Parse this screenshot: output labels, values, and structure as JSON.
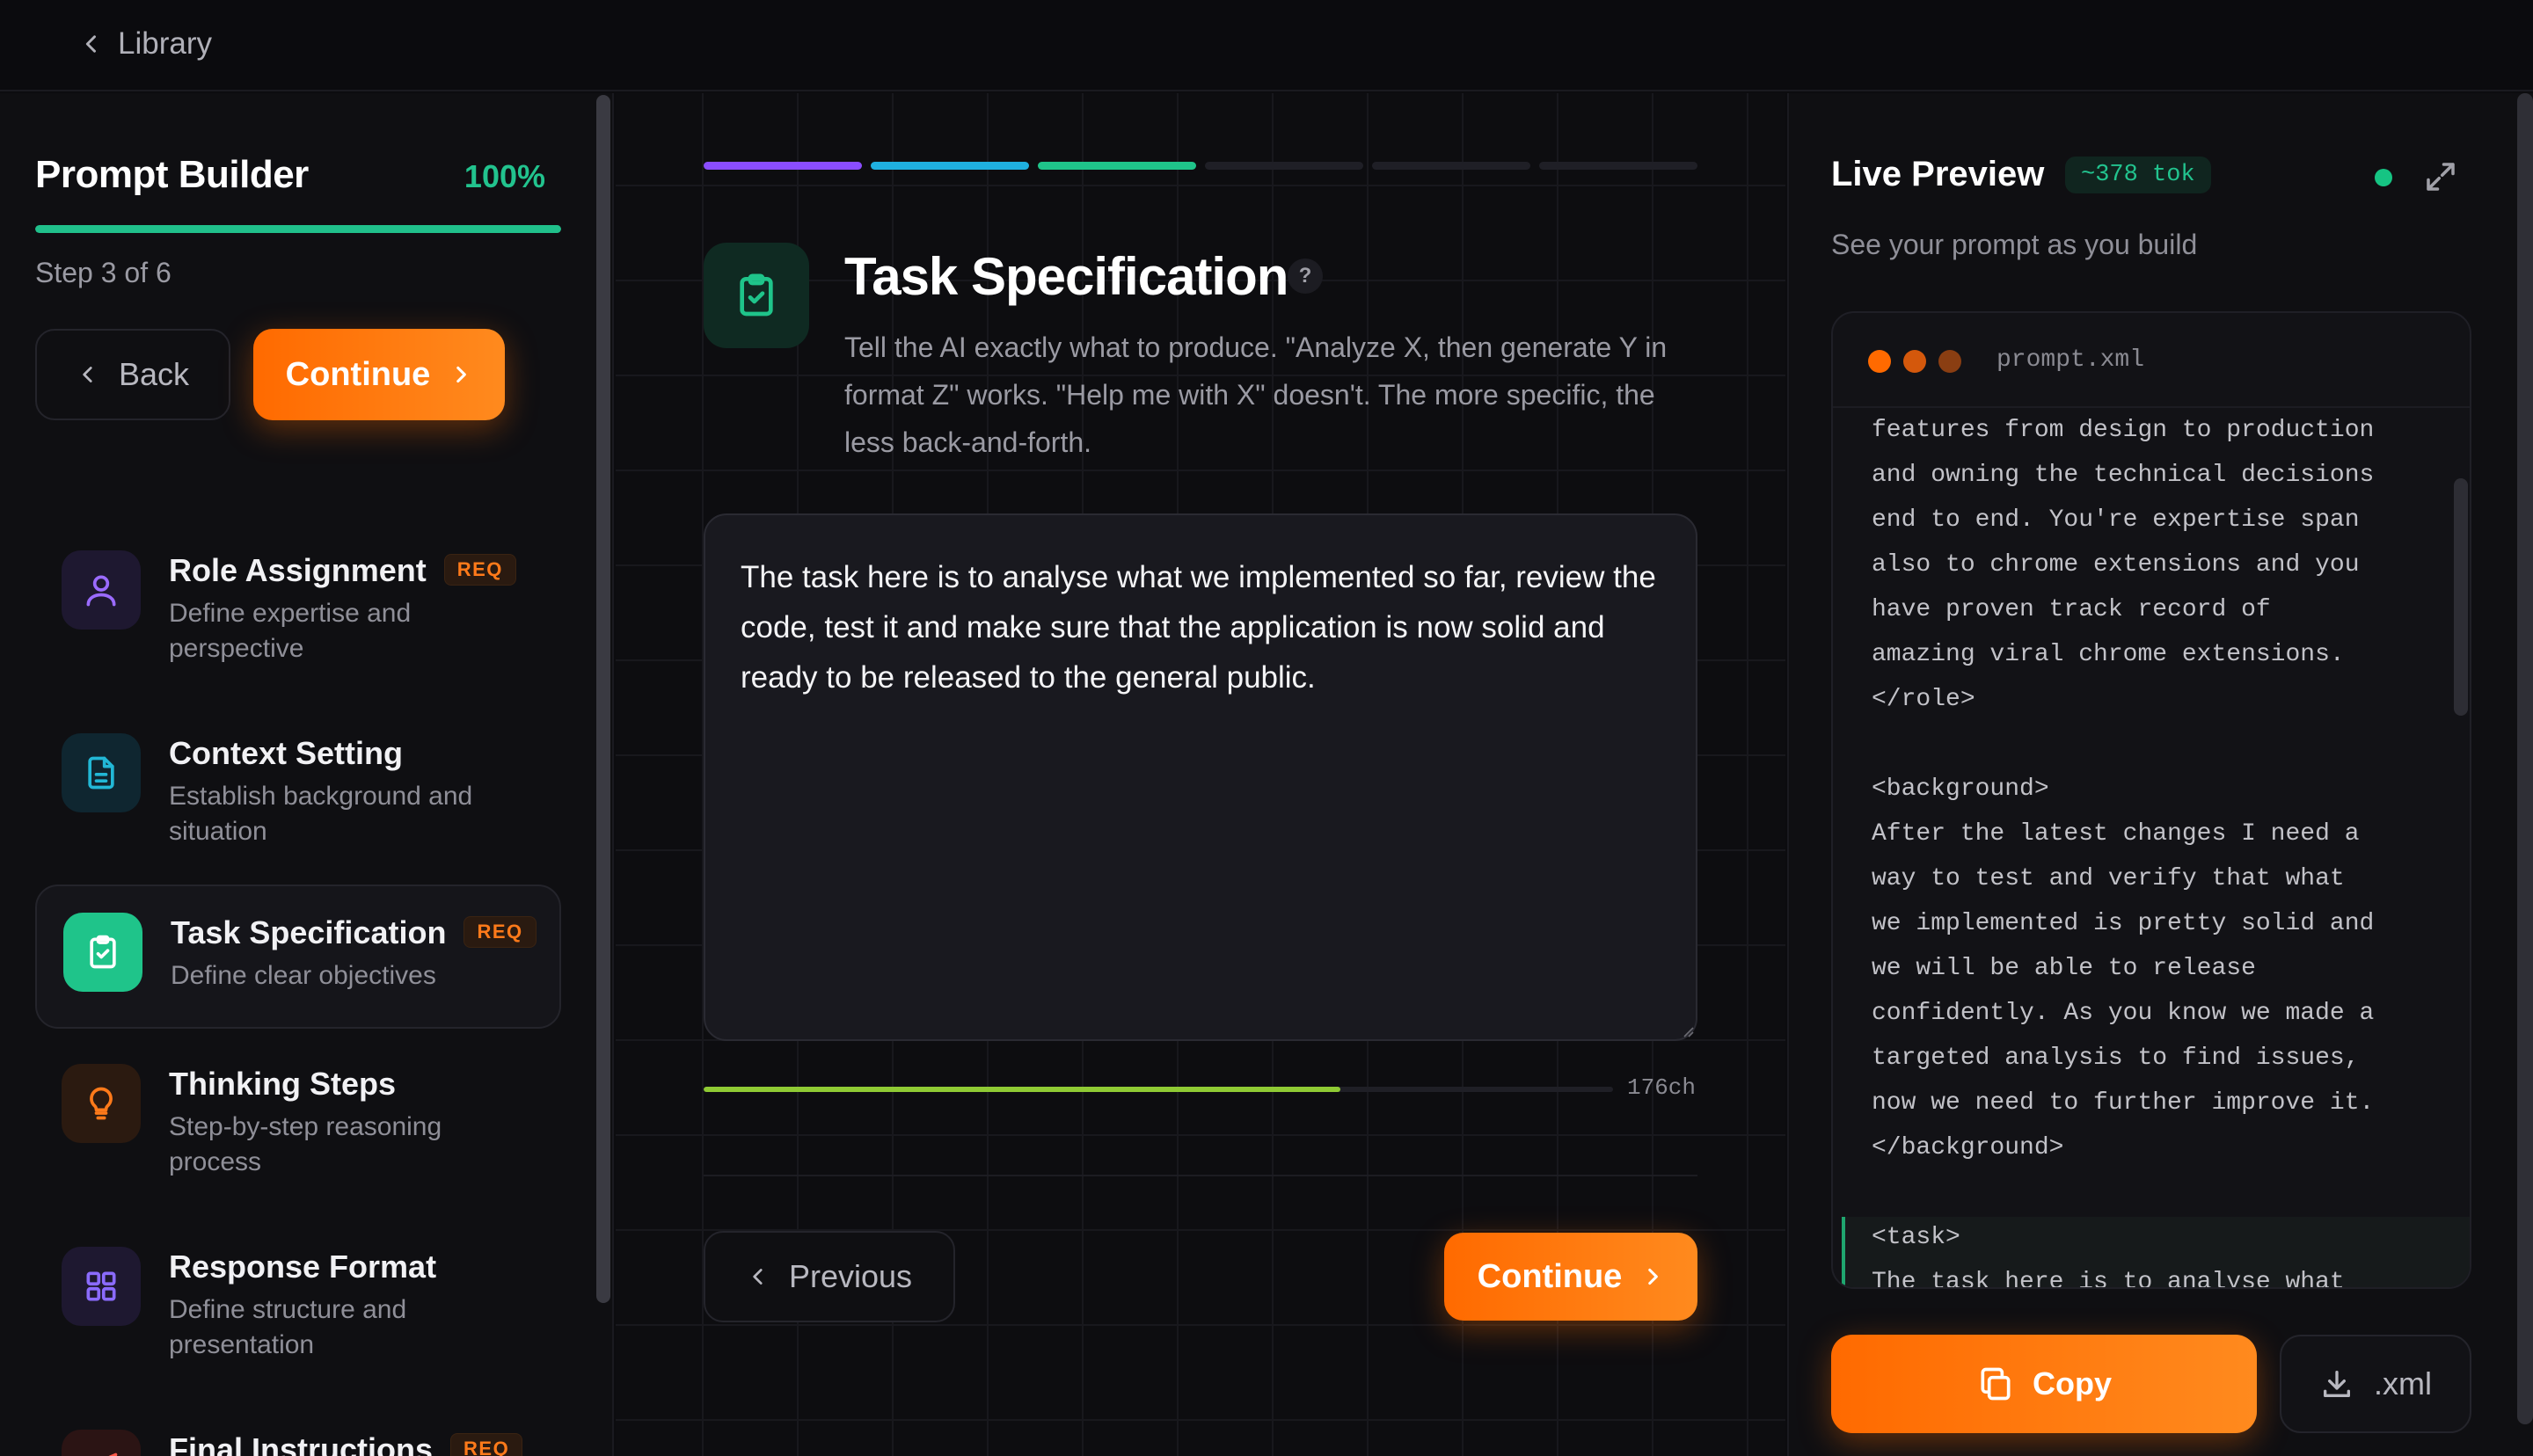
{
  "topbar": {
    "back_label": "Library"
  },
  "sidebar": {
    "title": "Prompt Builder",
    "percent": "100%",
    "progress_fraction": 1.0,
    "step_text": "Step 3 of 6",
    "back_label": "Back",
    "continue_label": "Continue",
    "req_badge": "REQ",
    "steps": [
      {
        "name": "Role Assignment",
        "desc": "Define expertise and perspective",
        "required": true,
        "icon": "user-icon",
        "color": "#9b6bff"
      },
      {
        "name": "Context Setting",
        "desc": "Establish background and situation",
        "required": false,
        "icon": "document-icon",
        "color": "#22b8d6"
      },
      {
        "name": "Task Specification",
        "desc": "Define clear objectives",
        "required": true,
        "icon": "clipboard-check-icon",
        "color": "#1fc48a",
        "active": true
      },
      {
        "name": "Thinking Steps",
        "desc": "Step-by-step reasoning process",
        "required": false,
        "icon": "lightbulb-icon",
        "color": "#ff7a1a"
      },
      {
        "name": "Response Format",
        "desc": "Define structure and presentation",
        "required": false,
        "icon": "grid-icon",
        "color": "#8b6bff"
      },
      {
        "name": "Final Instructions",
        "desc": "",
        "required": true,
        "icon": "send-icon",
        "color": "#ff5a4a"
      }
    ]
  },
  "main": {
    "segment_colors": [
      "#8a4dff",
      "#1fb0e0",
      "#1fc48a",
      "#1f1f26",
      "#1f1f26",
      "#1f1f26"
    ],
    "title": "Task Specification",
    "help": "?",
    "description": "Tell the AI exactly what to produce. \"Analyze X, then generate Y in format Z\" works. \"Help me with X\" doesn't. The more specific, the less back-and-forth.",
    "input_value": "The task here is to analyse what we implemented so far, review the code, test it and make sure that the application is now solid and ready to be released to the general public.",
    "char_fill_fraction": 0.7,
    "char_count": "176ch",
    "previous_label": "Previous",
    "continue_label": "Continue"
  },
  "preview": {
    "title": "Live Preview",
    "tokens": "~378 tok",
    "subtitle": "See your prompt as you build",
    "file_name": "prompt.xml",
    "dot_colors": [
      "#ff6a00",
      "#d4580c",
      "#8a3e12"
    ],
    "code_lines": [
      "features from design to production",
      "and owning the technical decisions",
      "end to end. You're expertise span",
      "also to chrome extensions and you",
      "have proven track record of",
      "amazing viral chrome extensions.",
      "</role>",
      "",
      "<background>",
      "After the latest changes I need a",
      "way to test and verify that what",
      "we implemented is pretty solid and",
      "we will be able to release",
      "confidently. As you know we made a",
      "targeted analysis to find issues,",
      "now we need to further improve it.",
      "</background>",
      "",
      "<task>",
      "The task here is to analyse what"
    ],
    "copy_label": "Copy",
    "download_label": ".xml"
  }
}
